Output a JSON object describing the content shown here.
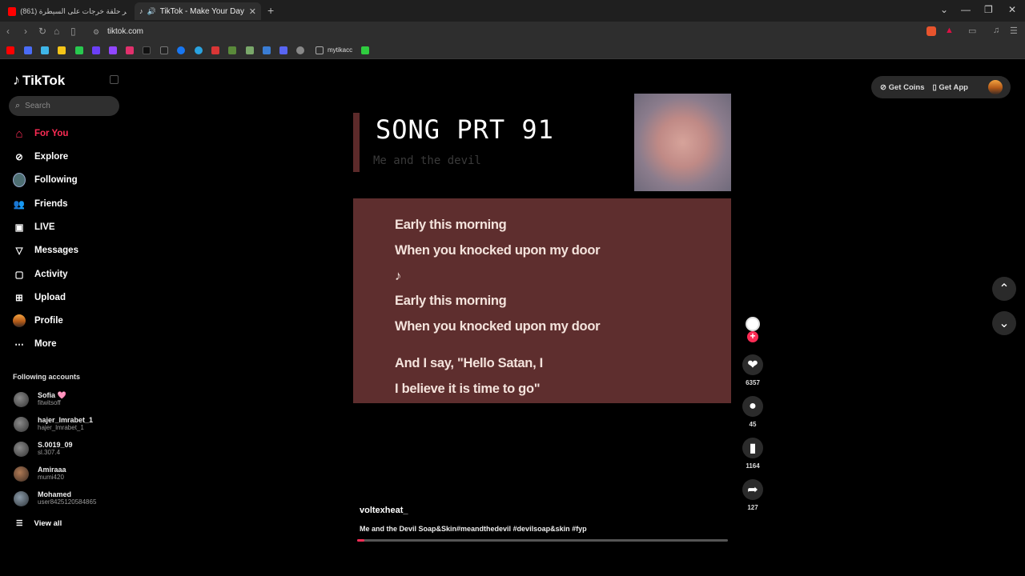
{
  "browser": {
    "tabs": [
      {
        "label": "(861) أكثر حلقة خرجات على السيطرة"
      },
      {
        "label": "TikTok - Make Your Day"
      }
    ],
    "url": "tiktok.com",
    "bookmark_folder": "mytikacc"
  },
  "sidebar": {
    "logo": "TikTok",
    "search_placeholder": "Search",
    "nav": [
      {
        "label": "For You"
      },
      {
        "label": "Explore"
      },
      {
        "label": "Following"
      },
      {
        "label": "Friends"
      },
      {
        "label": "LIVE"
      },
      {
        "label": "Messages"
      },
      {
        "label": "Activity"
      },
      {
        "label": "Upload"
      },
      {
        "label": "Profile"
      },
      {
        "label": "More"
      }
    ],
    "following_title": "Following accounts",
    "accounts": [
      {
        "name": "Sofia 🩷",
        "handle": "fitwitsoff"
      },
      {
        "name": "hajer_lmrabet_1",
        "handle": "hajer_lmrabet_1"
      },
      {
        "name": "S.0019_09",
        "handle": "sl.307.4"
      },
      {
        "name": "Amiraaa",
        "handle": "mumi420"
      },
      {
        "name": "Mohamed",
        "handle": "user8425120584865"
      }
    ],
    "view_all": "View all"
  },
  "header": {
    "get_coins": "Get Coins",
    "get_app": "Get App"
  },
  "video": {
    "title": "SONG PRT 91",
    "subtitle": "Me and the devil",
    "lyrics": [
      "Early this morning",
      "When you knocked upon my door",
      "♪",
      "Early this morning",
      "When you knocked upon my door",
      "And I say, \"Hello Satan, I",
      "I believe it is time to go\""
    ],
    "author": "voltexheat_",
    "description": "Me and the Devil Soap&Skin#meandthedevil #devilsoap&skin #fyp",
    "progress": 0.02
  },
  "actions": {
    "likes": "6357",
    "comments": "45",
    "saves": "1164",
    "shares": "127"
  },
  "colors": {
    "accent": "#fe2c55",
    "lyrics_bg": "#5e2e2e"
  }
}
